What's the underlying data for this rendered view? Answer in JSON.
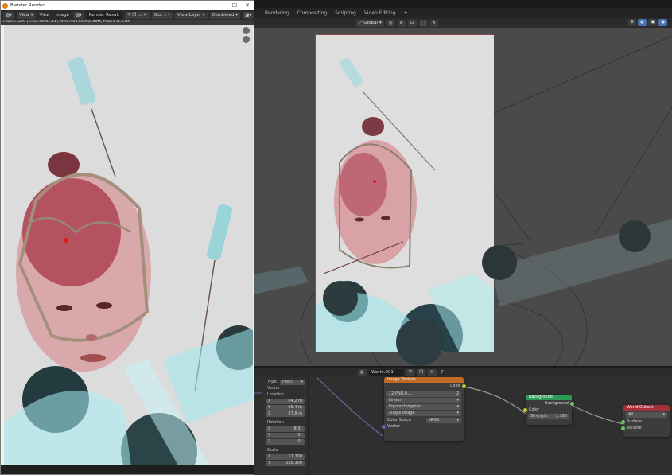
{
  "main": {
    "tabs": [
      "Rendering",
      "Compositing",
      "Scripting",
      "Video Editing",
      "+"
    ],
    "viewport_header": {
      "orientation": "Global"
    },
    "node_editor": {
      "world_name": "World.001",
      "nodes": {
        "image_texture": {
          "title": "Image Texture",
          "output_color": "Color",
          "image_name": "12 PNG.0...",
          "user_count": "2",
          "interpolation": "Linear",
          "projection": "Equirectangular",
          "source": "Single Image",
          "color_space_label": "Color Space",
          "color_space": "sRGB",
          "input_vector": "Vector"
        },
        "background": {
          "title": "Background",
          "output": "Background",
          "input_color": "Color",
          "strength_label": "Strength",
          "strength": "1.160"
        },
        "world_output": {
          "title": "World Output",
          "target": "All",
          "input_surface": "Surface",
          "input_volume": "Volume"
        }
      },
      "side_panel": {
        "type_label": "Type:",
        "type_value": "Point",
        "vector_label": "Vector",
        "location_label": "Location",
        "location": {
          "x": "64.2 m",
          "y": "85.4 m",
          "z": "87.8 m"
        },
        "rotation_label": "Rotation",
        "rotation": {
          "x": "8.3°",
          "y": "0°",
          "z": "0°"
        },
        "scale_label": "Scale",
        "scale": {
          "x": "11.700",
          "y": "216.300"
        }
      }
    }
  },
  "render_window": {
    "title": "Blender Render",
    "controls": {
      "minimize": "—",
      "maximize": "☐",
      "close": "✕"
    },
    "menus": [
      "View",
      "View",
      "Image"
    ],
    "image_name": "Render Result",
    "slot": "Slot 1",
    "layer": "View Layer",
    "pass": "Combined",
    "info": "Frame:1200 | Time:00:01.11 | Mem:403.69M (0.00M, Peak 571.67M)"
  },
  "colors": {
    "accent_blue": "#4772b3",
    "node_texture_header": "#c06a25",
    "node_shader_header": "#2a9a55",
    "node_output_header": "#a5303d",
    "socket_yellow": "#c7c729",
    "socket_purple": "#6363c7",
    "socket_green": "#63c763",
    "render_bg": "#d9d9d9",
    "blender_orange": "#e87d0d"
  }
}
